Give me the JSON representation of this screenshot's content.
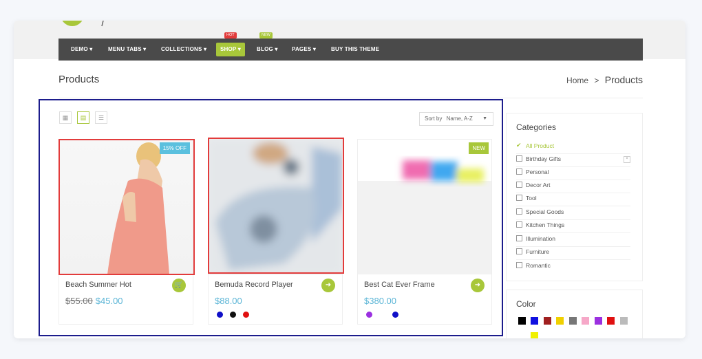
{
  "nav": {
    "items": [
      {
        "label": "DEMO ▾"
      },
      {
        "label": "MENU TABS ▾"
      },
      {
        "label": "COLLECTIONS ▾"
      },
      {
        "label": "SHOP ▾"
      },
      {
        "label": "BLOG ▾"
      },
      {
        "label": "PAGES ▾"
      },
      {
        "label": "BUY THIS THEME"
      }
    ],
    "badges": {
      "shop": "HOT",
      "blog": "NEW"
    },
    "active": "SHOP",
    "accent_color": "#a8c73a"
  },
  "page": {
    "title": "Products",
    "breadcrumb": {
      "home": "Home",
      "separator": ">",
      "current": "Products"
    }
  },
  "toolbar": {
    "view_modes": [
      "grid-4-icon",
      "grid-3-icon",
      "list-icon"
    ],
    "active_view": "grid-3-icon",
    "sort_label": "Sort by",
    "sort_value": "Name, A-Z"
  },
  "products": [
    {
      "name": "Beach Summer Hot",
      "badge": "15% OFF",
      "badge_color": "#5bc0de",
      "old_price": "$55.00",
      "price": "$45.00",
      "swatches": [],
      "action_icon": "cart-icon"
    },
    {
      "name": "Bemuda Record Player",
      "badge": "",
      "price": "$88.00",
      "swatches": [
        "#1010c8",
        "#111111",
        "#e01010"
      ],
      "action_icon": "arrow-right-icon"
    },
    {
      "name": "Best Cat Ever Frame",
      "badge": "NEW",
      "badge_color": "#a8c73a",
      "price": "$380.00",
      "swatches": [
        "#9b30e0",
        "#1010c8"
      ],
      "action_icon": "arrow-right-icon"
    }
  ],
  "categories": {
    "title": "Categories",
    "items": [
      {
        "label": "All Product",
        "checked": true
      },
      {
        "label": "Birthday Gifts",
        "checked": false
      },
      {
        "label": "Personal",
        "checked": false
      },
      {
        "label": "Decor Art",
        "checked": false
      },
      {
        "label": "Tool",
        "checked": false
      },
      {
        "label": "Special Goods",
        "checked": false
      },
      {
        "label": "Kitchen Things",
        "checked": false
      },
      {
        "label": "Illumination",
        "checked": false
      },
      {
        "label": "Furniture",
        "checked": false
      },
      {
        "label": "Romantic",
        "checked": false
      }
    ]
  },
  "color_filter": {
    "title": "Color",
    "colors": [
      "#000000",
      "#1010e0",
      "#a02020",
      "#f0d000",
      "#777777",
      "#f6a8c8",
      "#9b30e0",
      "#e01010",
      "#bbbbbb",
      "#f0f000"
    ]
  }
}
